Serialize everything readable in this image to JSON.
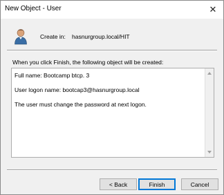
{
  "window": {
    "title": "New Object - User",
    "close_glyph": "✕"
  },
  "header": {
    "create_in_label": "Create in:",
    "create_in_path": "hasnurgroup.local/HIT",
    "icon": "user-icon"
  },
  "intro_text": "When you click Finish, the following object will be created:",
  "summary": {
    "lines": [
      "Full name: Bootcamp btcp. 3",
      "User logon name: bootcap3@hasnurgroup.local",
      "The user must change the password at next logon."
    ]
  },
  "buttons": {
    "back": "< Back",
    "finish": "Finish",
    "cancel": "Cancel"
  }
}
